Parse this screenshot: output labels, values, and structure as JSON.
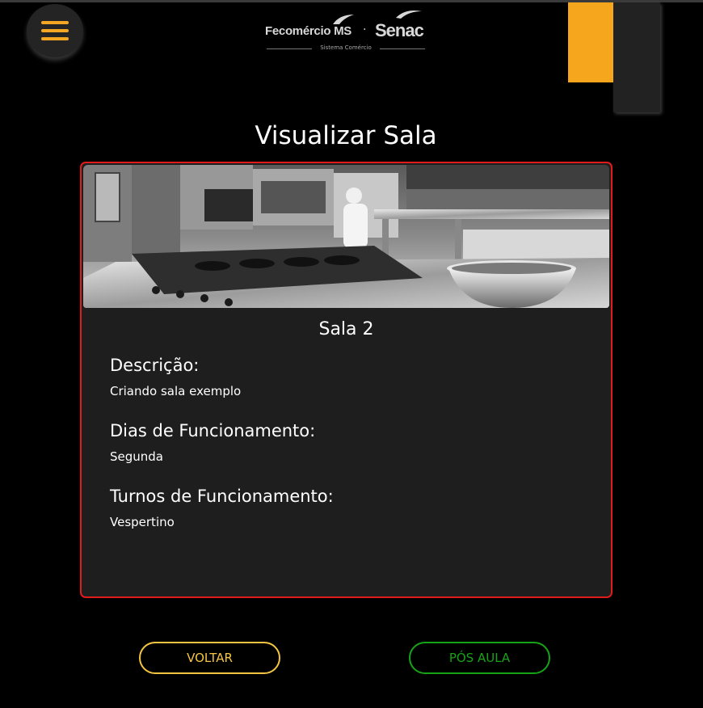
{
  "header": {
    "logo": {
      "fecomercio": "Fecomércio MS",
      "separator": "·",
      "senac": "Senac",
      "tagline": "Sistema Comércio"
    },
    "menu_icon": "hamburger-menu-icon",
    "accent_color": "#f5a623"
  },
  "page": {
    "title": "Visualizar Sala"
  },
  "room": {
    "image": "kitchen-photo",
    "name": "Sala 2",
    "description_label": "Descrição:",
    "description": "Criando sala exemplo",
    "days_label": "Dias de Funcionamento:",
    "days": "Segunda",
    "shifts_label": "Turnos de Funcionamento:",
    "shifts": "Vespertino",
    "border_color": "#e01b1b"
  },
  "actions": {
    "back_label": "VOLTAR",
    "back_color": "#f5c542",
    "post_class_label": "PÓS AULA",
    "post_class_color": "#16a316"
  }
}
